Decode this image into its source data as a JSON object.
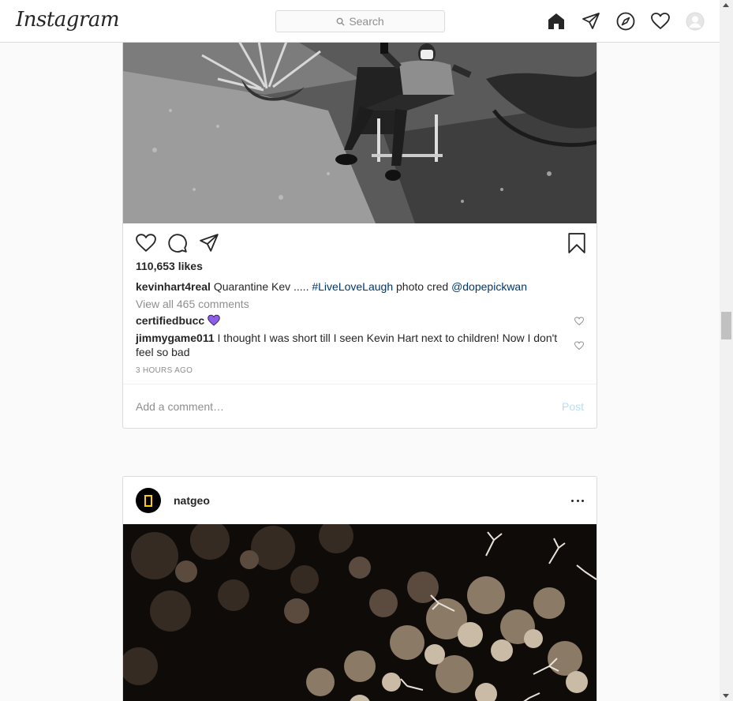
{
  "header": {
    "logo": "Instagram",
    "search_placeholder": "Search",
    "nav_icons": [
      "home-icon",
      "direct-icon",
      "explore-icon",
      "activity-heart-icon",
      "profile-avatar"
    ]
  },
  "post1": {
    "likes": "110,653 likes",
    "caption": {
      "user": "kevinhart4real",
      "text": "Quarantine Kev ..... ",
      "hashtag": "#LiveLoveLaugh",
      "middle": " photo cred ",
      "mention": "@dopepickwan"
    },
    "view_all": "View all 465 comments",
    "comments": [
      {
        "user": "certifiedbucc",
        "text": ""
      },
      {
        "user": "jimmygame011",
        "text": "I thought I was short till I seen Kevin Hart next to children! Now I don't feel so bad"
      }
    ],
    "time": "3 HOURS AGO",
    "comment_placeholder": "Add a comment…",
    "post_label": "Post"
  },
  "post2": {
    "user": "natgeo"
  },
  "colors": {
    "link": "#00376b",
    "muted": "#8e8e8e",
    "post_disabled": "#b2dffc",
    "purple_heart": "#8e5fe6",
    "natgeo_yellow": "#ffce00"
  }
}
